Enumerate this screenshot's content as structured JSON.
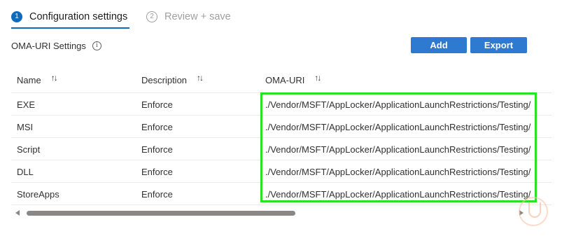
{
  "wizard": {
    "steps": [
      {
        "number": "1",
        "label": "Configuration settings"
      },
      {
        "number": "2",
        "label": "Review + save"
      }
    ]
  },
  "section": {
    "title": "OMA-URI Settings",
    "info_icon": "i"
  },
  "toolbar": {
    "add_label": "Add",
    "export_label": "Export"
  },
  "table": {
    "headers": [
      "Name",
      "Description",
      "OMA-URI"
    ],
    "sort_icon": "↑↓",
    "rows": [
      {
        "name": "EXE",
        "description": "Enforce",
        "oma_uri": "./Vendor/MSFT/AppLocker/ApplicationLaunchRestrictions/Testing/"
      },
      {
        "name": "MSI",
        "description": "Enforce",
        "oma_uri": "./Vendor/MSFT/AppLocker/ApplicationLaunchRestrictions/Testing/"
      },
      {
        "name": "Script",
        "description": "Enforce",
        "oma_uri": "./Vendor/MSFT/AppLocker/ApplicationLaunchRestrictions/Testing/"
      },
      {
        "name": "DLL",
        "description": "Enforce",
        "oma_uri": "./Vendor/MSFT/AppLocker/ApplicationLaunchRestrictions/Testing/"
      },
      {
        "name": "StoreApps",
        "description": "Enforce",
        "oma_uri": "./Vendor/MSFT/AppLocker/ApplicationLaunchRestrictions/Testing/"
      }
    ]
  },
  "colors": {
    "accent": "#0f6cbd",
    "button": "#2f7ad1",
    "highlight": "#27e322"
  }
}
